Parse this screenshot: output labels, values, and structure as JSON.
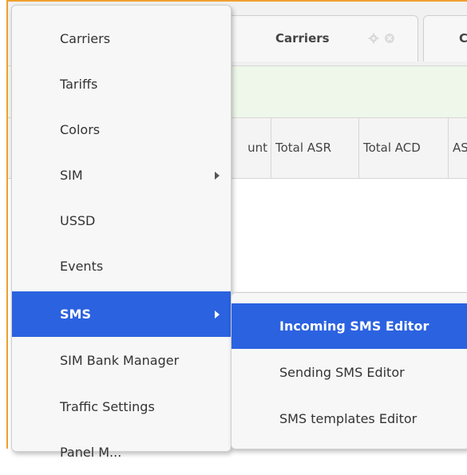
{
  "tabs": [
    {
      "label": "Carriers"
    },
    {
      "label": "Co"
    }
  ],
  "grid": {
    "columns": [
      "unt",
      "Total ASR",
      "Total ACD",
      "AS"
    ]
  },
  "menu": {
    "items": [
      {
        "label": "Carriers"
      },
      {
        "label": "Tariffs"
      },
      {
        "label": "Colors"
      },
      {
        "label": "SIM"
      },
      {
        "label": "USSD"
      },
      {
        "label": "Events"
      },
      {
        "label": "SMS"
      },
      {
        "label": "SIM Bank Manager"
      },
      {
        "label": "Traffic Settings"
      },
      {
        "label": "Panel M..."
      }
    ],
    "active": "SMS"
  },
  "submenu": {
    "items": [
      {
        "label": "Incoming SMS Editor"
      },
      {
        "label": "Sending SMS Editor"
      },
      {
        "label": "SMS templates Editor"
      }
    ],
    "active": "Incoming SMS Editor"
  },
  "colors": {
    "accent": "#2b62e0",
    "frame": "#f0a030",
    "filter_bg": "#eef7ea"
  }
}
